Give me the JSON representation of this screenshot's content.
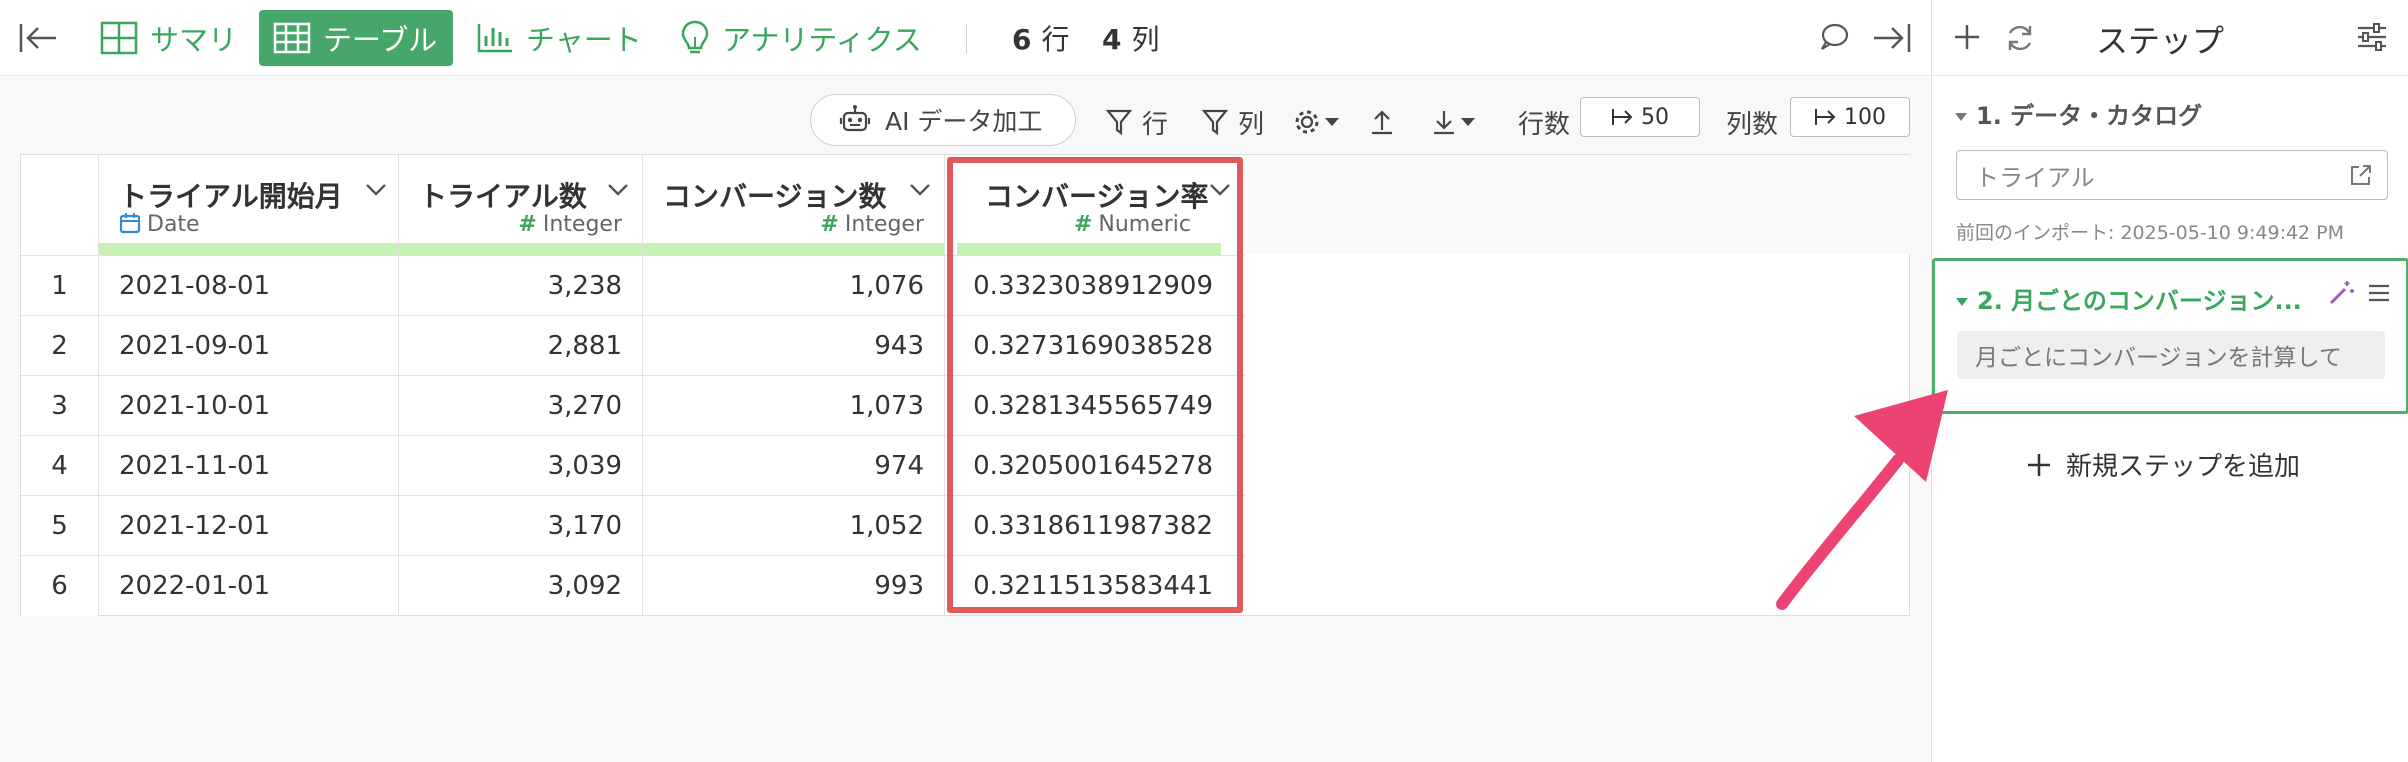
{
  "topbar": {
    "tabs": [
      {
        "label": "サマリ",
        "icon": "grid-icon"
      },
      {
        "label": "テーブル",
        "icon": "table-icon",
        "active": true
      },
      {
        "label": "チャート",
        "icon": "bar-chart-icon"
      },
      {
        "label": "アナリティクス",
        "icon": "lightbulb-icon"
      }
    ],
    "rows_num": "6",
    "rows_unit": "行",
    "cols_num": "4",
    "cols_unit": "列"
  },
  "toolbar": {
    "ai_label": "AI データ加工",
    "row_filter_label": "行",
    "col_filter_label": "列",
    "rows_label": "行数",
    "rows_value": "50",
    "cols_label": "列数",
    "cols_value": "100"
  },
  "table": {
    "columns": [
      {
        "name": "トライアル開始月",
        "type": "Date"
      },
      {
        "name": "トライアル数",
        "type": "Integer"
      },
      {
        "name": "コンバージョン数",
        "type": "Integer"
      },
      {
        "name": "コンバージョン率",
        "type": "Numeric"
      }
    ],
    "rows": [
      {
        "idx": "1",
        "date": "2021-08-01",
        "trials": "3,238",
        "conversions": "1,076",
        "rate": "0.3323038912909"
      },
      {
        "idx": "2",
        "date": "2021-09-01",
        "trials": "2,881",
        "conversions": "943",
        "rate": "0.3273169038528"
      },
      {
        "idx": "3",
        "date": "2021-10-01",
        "trials": "3,270",
        "conversions": "1,073",
        "rate": "0.3281345565749"
      },
      {
        "idx": "4",
        "date": "2021-11-01",
        "trials": "3,039",
        "conversions": "974",
        "rate": "0.3205001645278"
      },
      {
        "idx": "5",
        "date": "2021-12-01",
        "trials": "3,170",
        "conversions": "1,052",
        "rate": "0.3318611987382"
      },
      {
        "idx": "6",
        "date": "2022-01-01",
        "trials": "3,092",
        "conversions": "993",
        "rate": "0.3211513583441"
      }
    ]
  },
  "panel": {
    "title": "ステップ",
    "step1": {
      "title": "1. データ・カタログ",
      "dataset": "トライアル",
      "import_info": "前回のインポート: 2025-05-10 9:49:42 PM"
    },
    "step2": {
      "title": "2. 月ごとのコンバージョン...",
      "memo": "月ごとにコンバージョンを計算して"
    },
    "add_step": "新規ステップを追加"
  },
  "colors": {
    "accent_green": "#47a66b",
    "highlight_red": "#e05a5a",
    "arrow_pink": "#ec4372",
    "type_bar": "#c8f0b6"
  }
}
